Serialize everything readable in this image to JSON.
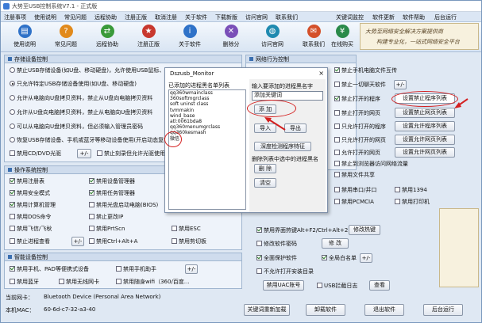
{
  "window": {
    "title": "大势至USB控制系统V7.1 - 正式版"
  },
  "menu": {
    "left": [
      "注册事项",
      "使用说明",
      "常见问题",
      "远程协助",
      "注册正版",
      "取消注册",
      "关于软件",
      "下载新版",
      "访问官网",
      "联系我们"
    ],
    "right": [
      "关键词监控",
      "软件更新",
      "软件帮助",
      "后台运行"
    ]
  },
  "toolbar": [
    {
      "label": "使用说明",
      "icon": "book-icon",
      "color": "#2f72c8"
    },
    {
      "label": "常见问题",
      "icon": "question-icon",
      "color": "#e18a1c"
    },
    {
      "label": "远程协助",
      "icon": "remote-icon",
      "color": "#3a9a3a"
    },
    {
      "label": "注册正版",
      "icon": "register-icon",
      "color": "#c8382e"
    },
    {
      "label": "关于软件",
      "icon": "info-icon",
      "color": "#2f72c8"
    },
    {
      "label": "删除分",
      "icon": "delete-icon",
      "color": "#7a4fb8"
    },
    {
      "label": "访问官网",
      "icon": "globe-icon",
      "color": "#1f8ab0"
    },
    {
      "label": "联系我们",
      "icon": "contact-icon",
      "color": "#d4502a"
    },
    {
      "label": "",
      "icon": "blank-icon",
      "color": "#dfe8f3"
    },
    {
      "label": "在线购买",
      "icon": "cart-icon",
      "color": "#2a8a4a"
    }
  ],
  "brand": {
    "line1": "大势至网络安全解决方案提供商",
    "line2": "构建专业化，一站式网络安全平台"
  },
  "storage": {
    "title": "存储设备控制",
    "options": [
      {
        "label": "禁止USB存储设备(如U盘、移动硬盘)，允许使用USB鼠标、键盘",
        "type": "radio",
        "checked": false
      },
      {
        "label": "只允许特定USB存储设备使用(如U盘、移动硬盘)",
        "type": "radio",
        "checked": true
      },
      {
        "label": "允许从电脑向U盘拷贝资料，禁止从U盘向电脑拷贝资料",
        "type": "radio",
        "checked": false
      },
      {
        "label": "允许从U盘向电脑拷贝资料，禁止从电脑向U盘拷贝资料",
        "type": "radio",
        "checked": false
      },
      {
        "label": "可以从电脑向U盘拷贝资料，但必须输入管理员密码",
        "type": "radio",
        "checked": false
      },
      {
        "label": "恢复USB存储设备、手机或蓝牙等移动设备使用(开启动态复制)",
        "type": "radio",
        "checked": false
      }
    ],
    "cd_label": "禁用CD/DVD光驱",
    "plus": "+/-",
    "burn_label": "禁止刻录但允许光驱使用"
  },
  "os": {
    "title": "操作系统控制",
    "left": [
      {
        "label": "禁用注册表",
        "checked": true
      },
      {
        "label": "禁用安全模式",
        "checked": true
      },
      {
        "label": "禁用计算机管理",
        "checked": true
      },
      {
        "label": "禁用DOS命令",
        "checked": false
      },
      {
        "label": "禁用飞信/飞秋",
        "checked": false
      },
      {
        "label": "禁止进程查看",
        "checked": false
      }
    ],
    "right": [
      {
        "label": "禁用设备管理器",
        "checked": true
      },
      {
        "label": "禁用任务管理器",
        "checked": true
      },
      {
        "label": "禁用光盘启动电脑(BIOS)",
        "checked": false
      },
      {
        "label": "禁止更改IP",
        "checked": false
      },
      {
        "label": "禁用PrtScn",
        "checked": false
      },
      {
        "label": "禁用Ctrl+Alt+A",
        "checked": false
      }
    ],
    "plus": "+/-",
    "extra": [
      {
        "label": "禁用ESC",
        "checked": false
      },
      {
        "label": "禁用剪切板",
        "checked": false
      }
    ]
  },
  "smart": {
    "title": "智能设备控制",
    "row1": [
      {
        "label": "禁用手机、PAD等便携式设备",
        "checked": true
      },
      {
        "label": "禁用手机助手",
        "checked": false
      }
    ],
    "plus": "+/-",
    "row2": [
      {
        "label": "禁用蓝牙",
        "checked": false
      },
      {
        "label": "禁用无线网卡",
        "checked": false
      },
      {
        "label": "禁用随身wifi（360/百度…",
        "checked": false
      }
    ]
  },
  "network": {
    "title": "网络行为控制",
    "items": [
      {
        "label": "禁止手机电脑文件互传",
        "checked": true
      },
      {
        "label": "禁止一切聊天软件",
        "checked": false
      },
      {
        "label": "禁止打开的程序",
        "checked": true
      },
      {
        "label": "禁止打开的网页",
        "checked": false
      },
      {
        "label": "只允许打开的程序",
        "checked": false
      },
      {
        "label": "只允许打开的网页",
        "checked": false
      },
      {
        "label": "允许打开的网页",
        "checked": false
      },
      {
        "label": "禁止到浏览器访问网络流量",
        "checked": false
      },
      {
        "label": "禁用文件共享",
        "checked": false
      }
    ],
    "plus": "+/-",
    "buttons": [
      "设置禁止程序列表",
      "设置禁止网页列表",
      "设置允许程序列表",
      "设置允许网页列表",
      "设置允许网页列表"
    ]
  },
  "ports": {
    "items": [
      {
        "label": "禁用串口/并口",
        "checked": false
      },
      {
        "label": "禁用1394",
        "checked": false
      },
      {
        "label": "禁用PCMCIA",
        "checked": false
      },
      {
        "label": "禁用打印机",
        "checked": false
      }
    ]
  },
  "other": {
    "hotkey_label": "禁用界面热键Alt+F2/Ctrl+Alt+2",
    "hotkey_button": "修改热键",
    "pwd_label": "修改软件密码",
    "pwd_button": "修 改",
    "protect_label": "全面保护软件",
    "white_label": "全局白名单",
    "plus": "+/-",
    "deny_label": "不允许打开安装目录",
    "uac_button": "禁用UAC账号",
    "usb_label": "USB拦截日志",
    "view_button": "查看"
  },
  "footer": {
    "nic_label": "当前网卡：",
    "nic_value": "Bluetooth Device (Personal Area Network)",
    "mac_label": "本机MAC：",
    "mac_value": "60-6d-c7-32-a3-40",
    "buttons": [
      "关键词重新加载",
      "卸载软件",
      "退出软件",
      "后台运行"
    ]
  },
  "dialog": {
    "title": "Dszusb_Monitor",
    "close": "×",
    "list_label": "已添加的进程黑名单列表",
    "list": [
      "qq360wmainclass",
      "360softmgrclass",
      "soft uninst class",
      "tvmmakin",
      "wind_base",
      "atl:0061bda8",
      "qq360menumgrclass",
      "qq360kesmash",
      "微信"
    ],
    "input_label": "输入要添加的进程黑名字",
    "input_value": "添加关键词",
    "add_button": "添 加",
    "import_button": "导入",
    "export_button": "导出",
    "detect_button": "深度检测程序特征",
    "delete_label": "删除列表中选中的进程黑名",
    "delete_button": "删 除",
    "clear_button": "清空"
  }
}
